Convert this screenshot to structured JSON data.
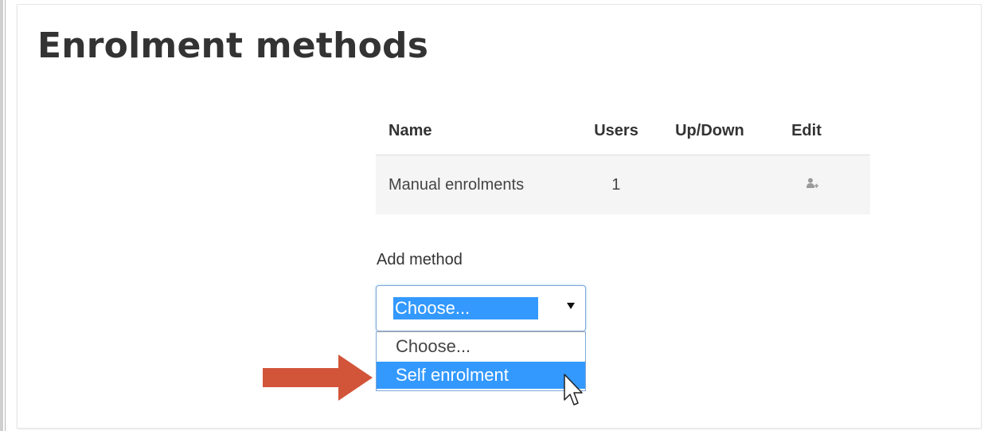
{
  "page": {
    "title": "Enrolment methods"
  },
  "table": {
    "headers": [
      "Name",
      "Users",
      "Up/Down",
      "Edit"
    ],
    "rows": [
      {
        "name": "Manual enrolments",
        "users": "1",
        "edit_icon": "enrol-users-icon"
      }
    ]
  },
  "add_method": {
    "label": "Add method",
    "selected": "Choose...",
    "options": [
      "Choose...",
      "Self enrolment"
    ],
    "highlighted_option": "Self enrolment"
  },
  "annotation": {
    "arrow_color": "#d2553a",
    "pointer": "mouse-cursor-icon"
  },
  "colors": {
    "selection": "#3399ff",
    "title": "#333333"
  }
}
